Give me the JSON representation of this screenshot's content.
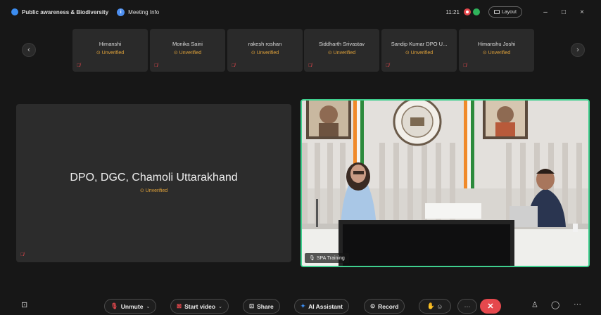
{
  "topbar": {
    "meeting_title": "Public awareness & Biodiversity",
    "meeting_info": "Meeting Info",
    "clock": "11:21",
    "layout_label": "Layout",
    "minimize": "–",
    "maximize": "□",
    "close": "×"
  },
  "strip": {
    "prev": "‹",
    "next": "›",
    "participants": [
      {
        "name": "Himanshi",
        "status": "Unverified"
      },
      {
        "name": "Monika Saini",
        "status": "Unverified"
      },
      {
        "name": "rakesh roshan",
        "status": "Unverified"
      },
      {
        "name": "Siddharth Srivastav",
        "status": "Unverified"
      },
      {
        "name": "Sandip Kumar DPO U...",
        "status": "Unverified"
      },
      {
        "name": "Himanshu Joshi",
        "status": "Unverified"
      }
    ]
  },
  "main": {
    "left_name": "DPO, DGC, Chamoli Uttarakhand",
    "left_status": "Unverified",
    "video_label": "SPA Training"
  },
  "toolbar": {
    "unmute": "Unmute",
    "start_video": "Start video",
    "share": "Share",
    "ai_assistant": "AI Assistant",
    "record": "Record",
    "more": "···",
    "end": "✕",
    "overflow": "···"
  },
  "colors": {
    "accent_green": "#3fcf8e",
    "unverified": "#e3a43a",
    "muted_red": "#e5484d"
  }
}
